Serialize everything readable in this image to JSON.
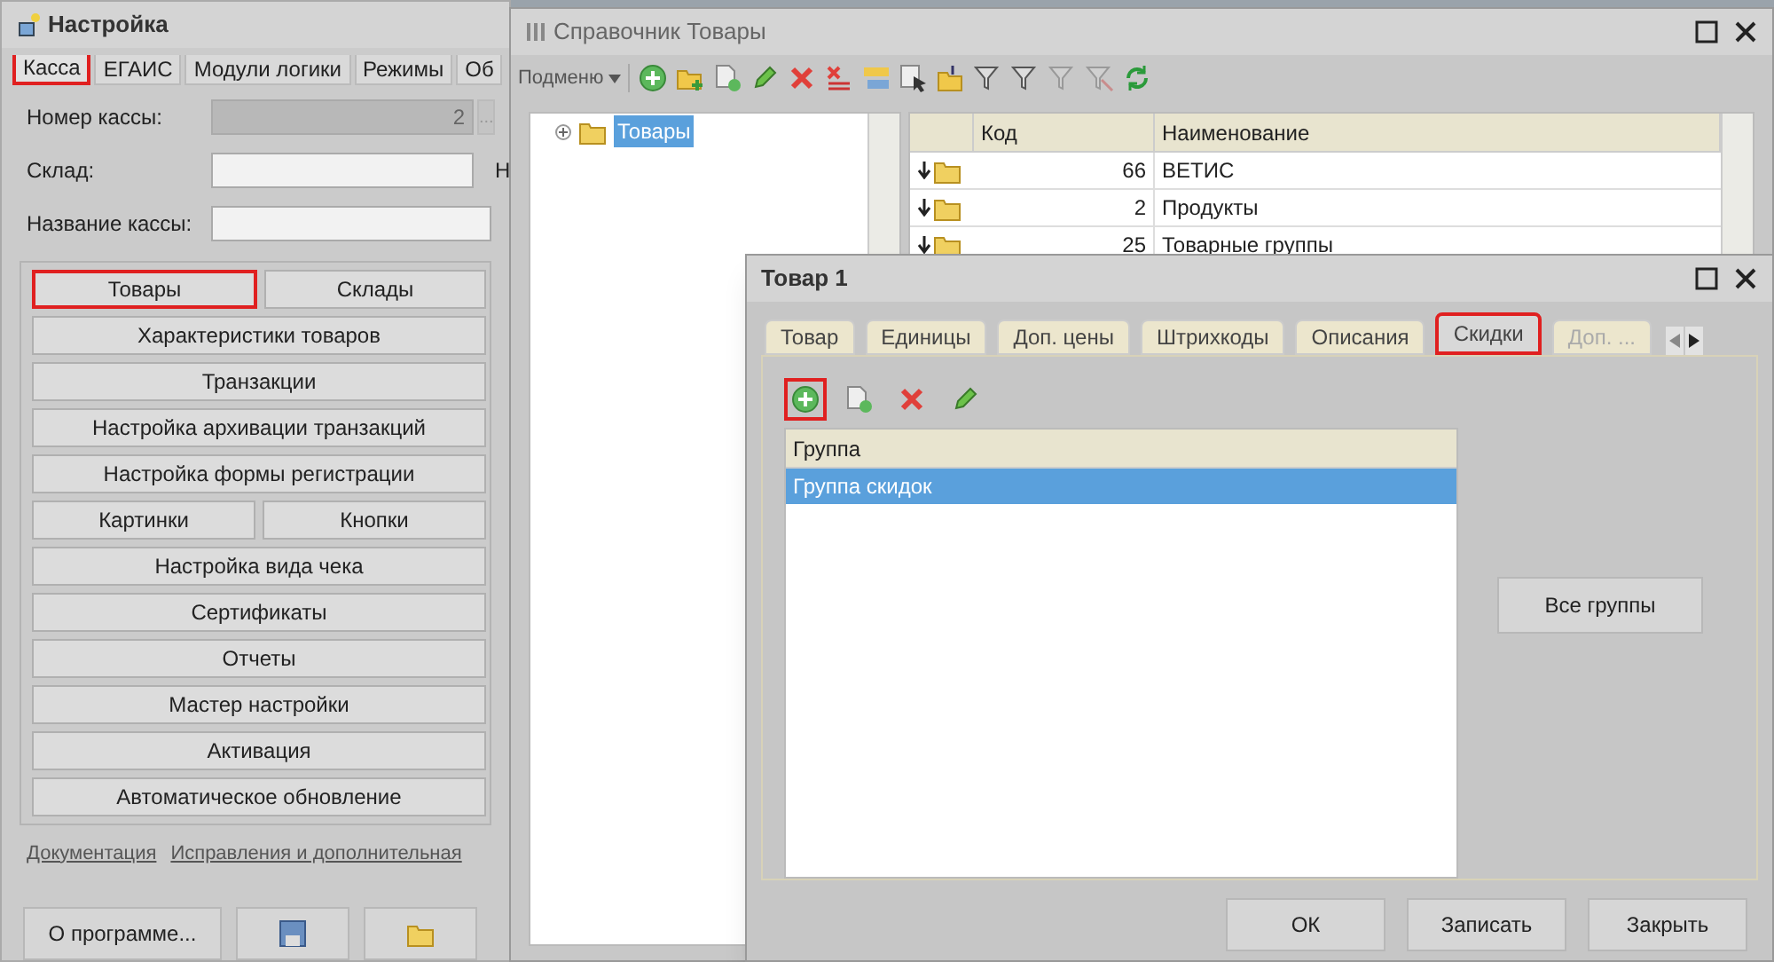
{
  "settings_window": {
    "title": "Настройка",
    "tabs": [
      {
        "label": "Касса",
        "selected": true,
        "highlighted": true
      },
      {
        "label": "ЕГАИС",
        "selected": false,
        "highlighted": false
      },
      {
        "label": "Модули логики",
        "selected": false,
        "highlighted": false
      },
      {
        "label": "Режимы",
        "selected": false,
        "highlighted": false
      },
      {
        "label": "Об",
        "selected": false,
        "highlighted": false
      }
    ],
    "fields": [
      {
        "label": "Номер кассы:",
        "value": "2",
        "disabled": true,
        "picker_button": "..."
      },
      {
        "label": "Склад:",
        "disabled": false,
        "side_label": "Н"
      },
      {
        "label": "Название кассы:",
        "disabled": false
      }
    ],
    "button_rows": [
      [
        {
          "label": "Товары",
          "highlighted": true
        },
        {
          "label": "Склады",
          "highlighted": false
        }
      ],
      [
        {
          "label": "Характеристики товаров",
          "highlighted": false
        }
      ],
      [
        {
          "label": "Транзакции",
          "highlighted": false
        }
      ],
      [
        {
          "label": "Настройка архивации транзакций",
          "highlighted": false
        }
      ],
      [
        {
          "label": "Настройка формы регистрации",
          "highlighted": false
        }
      ],
      [
        {
          "label": "Картинки",
          "highlighted": false
        },
        {
          "label": "Кнопки",
          "highlighted": false
        }
      ],
      [
        {
          "label": "Настройка вида чека",
          "highlighted": false
        }
      ],
      [
        {
          "label": "Сертификаты",
          "highlighted": false
        }
      ],
      [
        {
          "label": "Отчеты",
          "highlighted": false
        }
      ],
      [
        {
          "label": "Мастер настройки",
          "highlighted": false
        }
      ],
      [
        {
          "label": "Активация",
          "highlighted": false
        }
      ],
      [
        {
          "label": "Автоматическое обновление",
          "highlighted": false
        }
      ]
    ],
    "links": [
      "Документация",
      "Исправления и дополнительная"
    ],
    "footer_buttons": [
      {
        "kind": "text",
        "label": "О программе..."
      },
      {
        "kind": "save"
      },
      {
        "kind": "folder"
      }
    ]
  },
  "directory_window": {
    "title": "Справочник Товары",
    "toolbar": {
      "menu_label": "Подменю",
      "buttons": [
        {
          "kind": "add",
          "disabled": false
        },
        {
          "kind": "add-folder",
          "disabled": false
        },
        {
          "kind": "copy",
          "disabled": false
        },
        {
          "kind": "edit",
          "disabled": false
        },
        {
          "kind": "delete",
          "disabled": false
        },
        {
          "kind": "mark-delete",
          "disabled": false
        },
        {
          "kind": "hierarchy",
          "disabled": false
        },
        {
          "kind": "select",
          "disabled": false
        },
        {
          "kind": "move",
          "disabled": false
        },
        {
          "kind": "filter",
          "disabled": false
        },
        {
          "kind": "filter",
          "disabled": false
        },
        {
          "kind": "filter",
          "disabled": true
        },
        {
          "kind": "filter-off",
          "disabled": true
        },
        {
          "kind": "refresh",
          "disabled": false
        }
      ]
    },
    "tree": [
      {
        "label": "Товары",
        "selected": true
      }
    ],
    "table": {
      "columns": [
        "Код",
        "Наименование"
      ],
      "rows": [
        {
          "code": "66",
          "name": "ВЕТИС"
        },
        {
          "code": "2",
          "name": "Продукты"
        },
        {
          "code": "25",
          "name": "Товарные группы"
        }
      ]
    }
  },
  "item_window": {
    "title": "Товар 1",
    "tabs": [
      {
        "label": "Товар",
        "selected": false,
        "highlighted": false,
        "disabled": false
      },
      {
        "label": "Единицы",
        "selected": false,
        "highlighted": false,
        "disabled": false
      },
      {
        "label": "Доп. цены",
        "selected": false,
        "highlighted": false,
        "disabled": false
      },
      {
        "label": "Штрихкоды",
        "selected": false,
        "highlighted": false,
        "disabled": false
      },
      {
        "label": "Описания",
        "selected": false,
        "highlighted": false,
        "disabled": false
      },
      {
        "label": "Скидки",
        "selected": true,
        "highlighted": true,
        "disabled": false
      },
      {
        "label": "Доп. ...",
        "selected": false,
        "highlighted": false,
        "disabled": true
      }
    ],
    "toolbar": [
      {
        "kind": "add",
        "highlighted": true
      },
      {
        "kind": "copy",
        "highlighted": false
      },
      {
        "kind": "delete",
        "highlighted": false
      },
      {
        "kind": "edit",
        "highlighted": false
      }
    ],
    "table": {
      "column": "Группа",
      "rows": [
        {
          "name": "Группа скидок",
          "selected": true
        }
      ]
    },
    "side_button": "Все группы",
    "footer_buttons": [
      "ОК",
      "Записать",
      "Закрыть"
    ]
  }
}
